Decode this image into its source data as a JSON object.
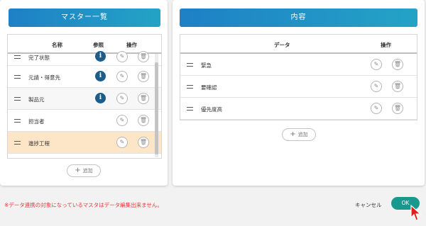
{
  "left_panel": {
    "title": "マスター一覧",
    "columns": {
      "name": "名称",
      "ref": "参照",
      "ops": "操作"
    },
    "rows": [
      {
        "label": "完了状態"
      },
      {
        "label": "元請・得意先"
      },
      {
        "label": "製品元"
      },
      {
        "label": "担当者"
      },
      {
        "label": "進捗工程"
      }
    ],
    "add_label": "追加"
  },
  "right_panel": {
    "title": "内容",
    "columns": {
      "data": "データ",
      "ops": "操作"
    },
    "rows": [
      {
        "label": "緊急"
      },
      {
        "label": "要確認"
      },
      {
        "label": "優先度高"
      }
    ],
    "add_label": "追加"
  },
  "footer": {
    "error_text": "※データ連携の対象になっているマスタはデータ編集出来ません。",
    "cancel_label": "キャンセル",
    "ok_label": "OK"
  },
  "colors": {
    "header_gradient_start": "#1e80c6",
    "header_gradient_end": "#24a3c6",
    "ok_button": "#179a8d",
    "error_text": "#e53935",
    "highlight_row": "#fde6c7",
    "info_icon": "#1c5d8a"
  },
  "icons": {
    "drag": "drag-handle-icon",
    "info": "info-icon",
    "edit": "pencil-icon",
    "delete": "trash-icon",
    "add": "plus-icon"
  }
}
